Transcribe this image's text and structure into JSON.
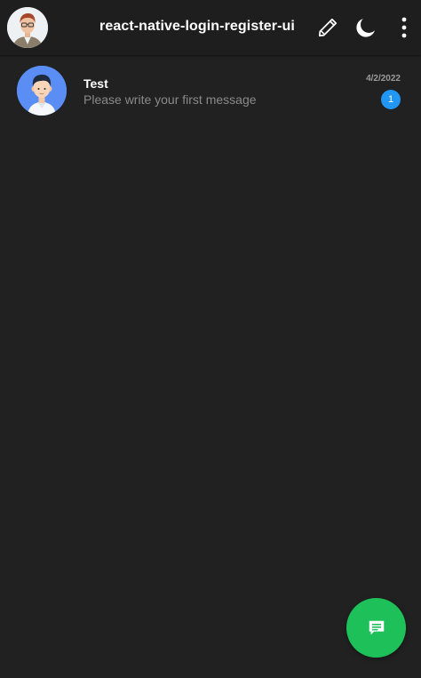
{
  "header": {
    "title": "react-native-login-register-ui",
    "profile_avatar_icon": "user-avatar",
    "actions": [
      {
        "icon": "pencil-icon"
      },
      {
        "icon": "moon-icon"
      },
      {
        "icon": "more-vertical-icon"
      }
    ]
  },
  "chats": [
    {
      "name": "Test",
      "preview": "Please write your first message",
      "date": "4/2/2022",
      "unread": "1",
      "avatar_icon": "user-avatar"
    }
  ],
  "fab": {
    "icon": "new-message-icon"
  },
  "colors": {
    "background": "#212121",
    "header": "#1e1e1e",
    "badge": "#2196f3",
    "fab": "#1ec05a",
    "preview_text": "#8a8a8a"
  }
}
